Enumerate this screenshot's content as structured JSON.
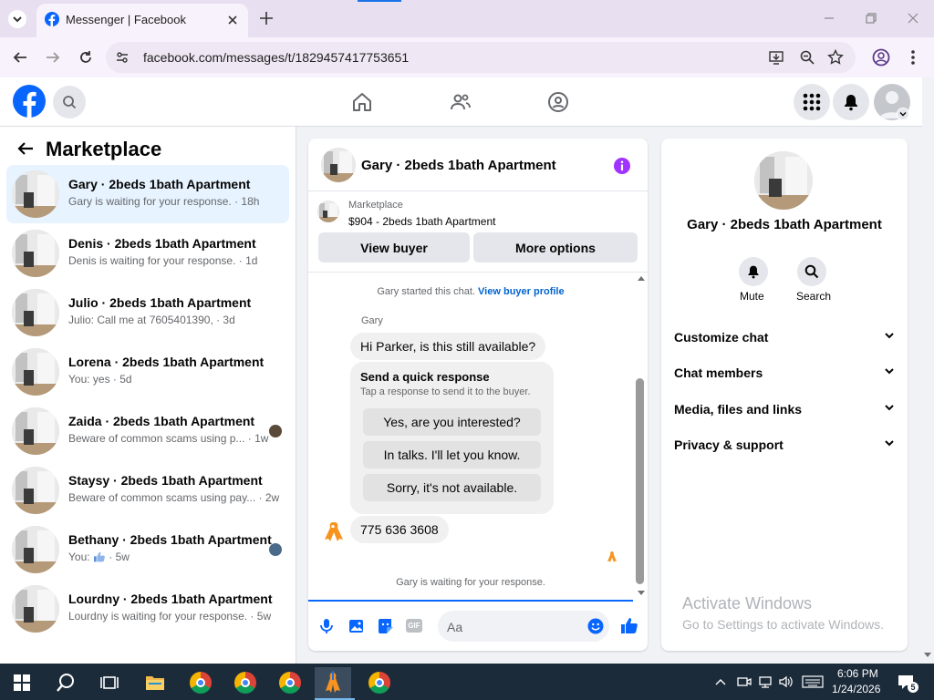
{
  "browser": {
    "tab_title": "Messenger | Facebook",
    "url": "facebook.com/messages/t/1829457417753651"
  },
  "sidebar": {
    "title": "Marketplace",
    "conversations": [
      {
        "name": "Gary · 2beds 1bath Apartment",
        "preview": "Gary is waiting for your response. · 18h",
        "selected": true
      },
      {
        "name": "Denis · 2beds 1bath Apartment",
        "preview": "Denis is waiting for your response. · 1d"
      },
      {
        "name": "Julio · 2beds 1bath Apartment",
        "preview": "Julio: Call me at 7605401390, · 3d"
      },
      {
        "name": "Lorena · 2beds 1bath Apartment",
        "preview": "You: yes · 5d"
      },
      {
        "name": "Zaida · 2beds 1bath Apartment",
        "preview": "Beware of common scams using p... · 1w"
      },
      {
        "name": "Staysy · 2beds 1bath Apartment",
        "preview": "Beware of common scams using pay... · 2w"
      },
      {
        "name": "Bethany · 2beds 1bath Apartment",
        "preview_prefix": "You: ",
        "preview_suffix": " · 5w"
      },
      {
        "name": "Lourdny · 2beds 1bath Apartment",
        "preview": "Lourdny is waiting for your response. · 5w"
      }
    ]
  },
  "chat": {
    "header_title": "Gary · 2beds 1bath Apartment",
    "listing_label": "Marketplace",
    "listing_title": "$904 - 2beds 1bath Apartment",
    "view_buyer": "View buyer",
    "more_options": "More options",
    "started_text": "Gary started this chat.",
    "view_profile_link": "View buyer profile",
    "sender_name": "Gary",
    "message1": "Hi Parker, is this still available?",
    "quick_title": "Send a quick response",
    "quick_subtitle": "Tap a response to send it to the buyer.",
    "quick_options": [
      "Yes, are you interested?",
      "In talks. I'll let you know.",
      "Sorry, it's not available."
    ],
    "message2": "775 636 3608",
    "waiting_text": "Gary is waiting for your response.",
    "composer_placeholder": "Aa"
  },
  "details": {
    "name": "Gary · 2beds 1bath Apartment",
    "mute_label": "Mute",
    "search_label": "Search",
    "menu": [
      "Customize chat",
      "Chat members",
      "Media, files and links",
      "Privacy & support"
    ]
  },
  "watermark": {
    "line1": "Activate Windows",
    "line2": "Go to Settings to activate Windows."
  },
  "taskbar": {
    "time": "6:06 PM",
    "date": "1/24/2026",
    "notification_count": "5"
  },
  "colors": {
    "accent": "#0866ff",
    "purple": "#a033ff",
    "chat_link": "#0064d1"
  }
}
